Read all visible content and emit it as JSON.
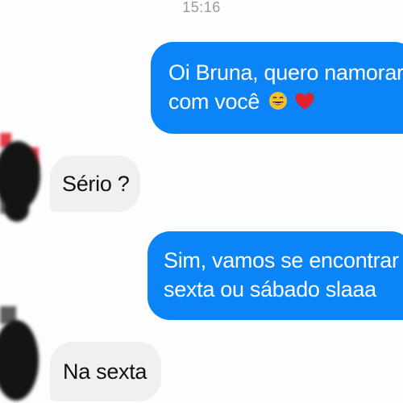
{
  "status_bar": {
    "time": "15:16"
  },
  "conversation": {
    "messages": [
      {
        "direction": "sent",
        "text_line1": "Oi Bruna, quero namorar",
        "text_line2": "com você",
        "emoji": [
          "grinning-sweat-emoji",
          "red-heart-emoji"
        ]
      },
      {
        "direction": "received",
        "text": "Sério ?"
      },
      {
        "direction": "sent",
        "text_line1": "Sim, vamos se encontrar",
        "text_line2": "sexta ou sábado slaaa"
      },
      {
        "direction": "received",
        "text": "Na sexta"
      }
    ]
  },
  "colors": {
    "sent_bubble": "#0a84f6",
    "received_bubble": "#f0f0f0",
    "sent_text": "#ffffff",
    "received_text": "#111111",
    "timestamp": "#9a9a9a"
  }
}
